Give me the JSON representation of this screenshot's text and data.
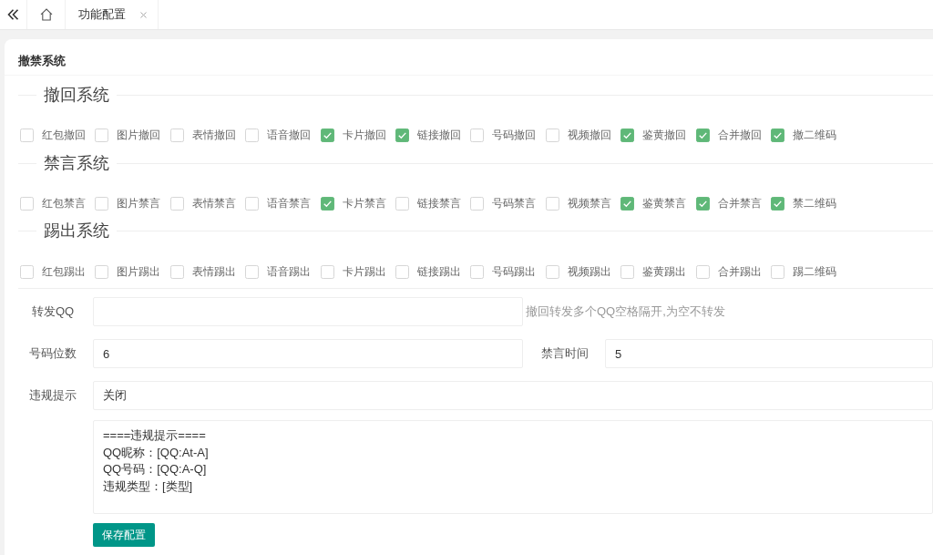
{
  "tab_bar": {
    "tabs": [
      {
        "kind": "home"
      },
      {
        "kind": "page",
        "label": "功能配置",
        "closable": true
      }
    ]
  },
  "panel": {
    "title": "撤禁系统",
    "sections": [
      {
        "legend": "撤回系统",
        "options": [
          {
            "label": "红包撤回",
            "checked": false
          },
          {
            "label": "图片撤回",
            "checked": false
          },
          {
            "label": "表情撤回",
            "checked": false
          },
          {
            "label": "语音撤回",
            "checked": false
          },
          {
            "label": "卡片撤回",
            "checked": true
          },
          {
            "label": "链接撤回",
            "checked": true
          },
          {
            "label": "号码撤回",
            "checked": false
          },
          {
            "label": "视频撤回",
            "checked": false
          },
          {
            "label": "鉴黄撤回",
            "checked": true
          },
          {
            "label": "合并撤回",
            "checked": true
          },
          {
            "label": "撤二维码",
            "checked": true
          }
        ]
      },
      {
        "legend": "禁言系统",
        "options": [
          {
            "label": "红包禁言",
            "checked": false
          },
          {
            "label": "图片禁言",
            "checked": false
          },
          {
            "label": "表情禁言",
            "checked": false
          },
          {
            "label": "语音禁言",
            "checked": false
          },
          {
            "label": "卡片禁言",
            "checked": true
          },
          {
            "label": "链接禁言",
            "checked": false
          },
          {
            "label": "号码禁言",
            "checked": false
          },
          {
            "label": "视频禁言",
            "checked": false
          },
          {
            "label": "鉴黄禁言",
            "checked": true
          },
          {
            "label": "合并禁言",
            "checked": true
          },
          {
            "label": "禁二维码",
            "checked": true
          }
        ]
      },
      {
        "legend": "踢出系统",
        "options": [
          {
            "label": "红包踢出",
            "checked": false
          },
          {
            "label": "图片踢出",
            "checked": false
          },
          {
            "label": "表情踢出",
            "checked": false
          },
          {
            "label": "语音踢出",
            "checked": false
          },
          {
            "label": "卡片踢出",
            "checked": false
          },
          {
            "label": "链接踢出",
            "checked": false
          },
          {
            "label": "号码踢出",
            "checked": false
          },
          {
            "label": "视频踢出",
            "checked": false
          },
          {
            "label": "鉴黄踢出",
            "checked": false
          },
          {
            "label": "合并踢出",
            "checked": false
          },
          {
            "label": "踢二维码",
            "checked": false
          }
        ]
      }
    ],
    "form": {
      "rows": [
        {
          "fields": [
            {
              "kind": "input",
              "label": "转发QQ",
              "help": "撤回转发多个QQ空格隔开,为空不转发"
            }
          ]
        },
        {
          "fields": [
            {
              "kind": "input",
              "label": "号码位数",
              "value": "6"
            },
            {
              "kind": "input",
              "label": "禁言时间",
              "value": "5"
            }
          ]
        },
        {
          "fields": [
            {
              "kind": "select",
              "label": "违规提示",
              "value": "关闭"
            }
          ]
        },
        {
          "fields": [
            {
              "kind": "textarea",
              "value": "====违规提示====\nQQ昵称：[QQ:At-A]\nQQ号码：[QQ:A-Q]\n违规类型：[类型]"
            }
          ]
        }
      ],
      "submit_label": "保存配置"
    }
  }
}
